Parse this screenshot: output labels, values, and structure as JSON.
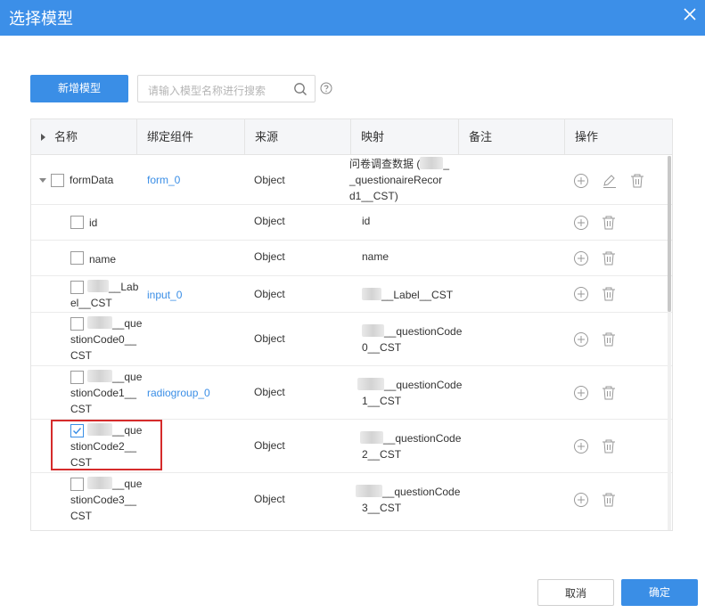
{
  "dialog": {
    "title": "选择模型",
    "add_button": "新增模型",
    "search_placeholder": "请输入模型名称进行搜索",
    "cancel": "取消",
    "confirm": "确定"
  },
  "columns": [
    "名称",
    "绑定组件",
    "来源",
    "映射",
    "备注",
    "操作"
  ],
  "rows": [
    {
      "name": "formData",
      "component": "form_0",
      "source": "Object",
      "mapping": [
        "问卷调查数据 (",
        "_questionaireRecor",
        "d1__CST)"
      ],
      "checked": false,
      "tree": "parent"
    },
    {
      "name": "id",
      "component": "",
      "source": "Object",
      "mapping": [
        "id"
      ],
      "checked": false
    },
    {
      "name": "name",
      "component": "",
      "source": "Object",
      "mapping": [
        "name"
      ],
      "checked": false
    },
    {
      "name": [
        "__Lab",
        "el__CST"
      ],
      "component": "input_0",
      "source": "Object",
      "mapping": [
        "__Label__CST"
      ],
      "checked": false
    },
    {
      "name": [
        "__que",
        "stionCode0__",
        "CST"
      ],
      "component": "",
      "source": "Object",
      "mapping": [
        "__questionCode",
        "0__CST"
      ],
      "checked": false
    },
    {
      "name": [
        "__que",
        "stionCode1__",
        "CST"
      ],
      "component": "radiogroup_0",
      "source": "Object",
      "mapping": [
        "__questionCode",
        "1__CST"
      ],
      "checked": false
    },
    {
      "name": [
        "__que",
        "stionCode2__",
        "CST"
      ],
      "component": "",
      "source": "Object",
      "mapping": [
        "__questionCode",
        "2__CST"
      ],
      "checked": true
    },
    {
      "name": [
        "__que",
        "stionCode3__",
        "CST"
      ],
      "component": "",
      "source": "Object",
      "mapping": [
        "__questionCode",
        "3__CST"
      ],
      "checked": false
    }
  ],
  "colors": {
    "header": "#3c8fe8",
    "primary": "#3a8ee6",
    "highlight": "#d52b2b"
  },
  "icons": {
    "close": "close-icon",
    "search": "search-icon",
    "help": "help-icon",
    "add": "plus-circle-icon",
    "edit": "edit-icon",
    "delete": "trash-icon"
  }
}
